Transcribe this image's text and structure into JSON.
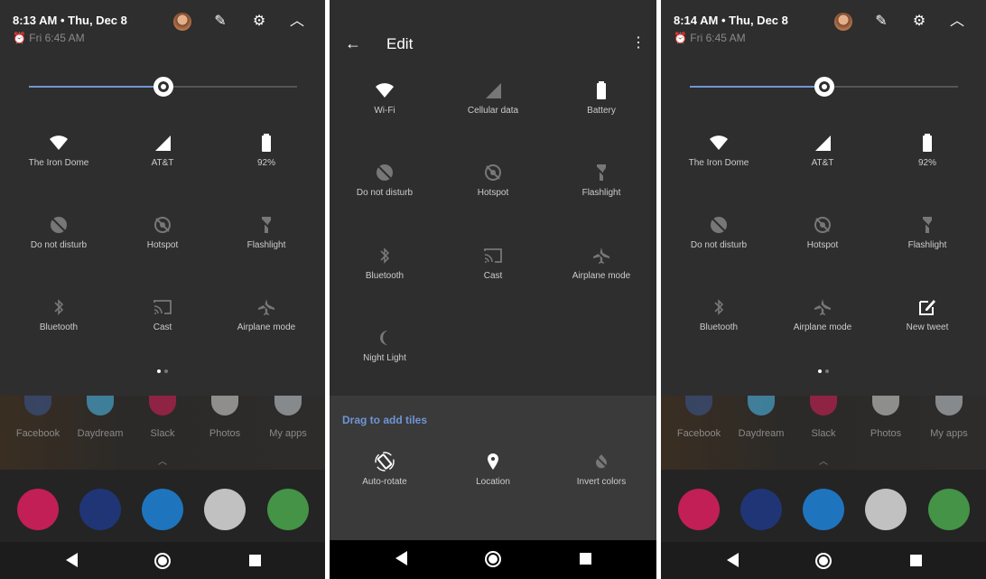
{
  "colors": {
    "accent": "#6f95d6",
    "active_icon": "#ffffff",
    "inactive_icon": "#777777"
  },
  "panel1": {
    "time": "8:13 AM • Thu, Dec 8",
    "alarm": "Fri 6:45 AM",
    "brightness": 0.5,
    "tiles": [
      {
        "label": "The Iron Dome",
        "icon": "wifi-icon",
        "active": true
      },
      {
        "label": "AT&T",
        "icon": "cellular-icon",
        "active": true
      },
      {
        "label": "92%",
        "icon": "battery-icon",
        "active": true
      },
      {
        "label": "Do not disturb",
        "icon": "dnd-icon",
        "active": false
      },
      {
        "label": "Hotspot",
        "icon": "hotspot-icon",
        "active": false
      },
      {
        "label": "Flashlight",
        "icon": "flashlight-icon",
        "active": false
      },
      {
        "label": "Bluetooth",
        "icon": "bluetooth-icon",
        "active": false
      },
      {
        "label": "Cast",
        "icon": "cast-icon",
        "active": false
      },
      {
        "label": "Airplane mode",
        "icon": "airplane-icon",
        "active": false
      }
    ],
    "page": 1,
    "pages": 2
  },
  "panel2": {
    "title": "Edit",
    "tiles": [
      {
        "label": "Wi-Fi",
        "icon": "wifi-icon",
        "active": true
      },
      {
        "label": "Cellular data",
        "icon": "cellular-icon",
        "active": false
      },
      {
        "label": "Battery",
        "icon": "battery-icon",
        "active": true
      },
      {
        "label": "Do not disturb",
        "icon": "dnd-icon",
        "active": false
      },
      {
        "label": "Hotspot",
        "icon": "hotspot-icon",
        "active": false
      },
      {
        "label": "Flashlight",
        "icon": "flashlight-icon",
        "active": false
      },
      {
        "label": "Bluetooth",
        "icon": "bluetooth-icon",
        "active": false
      },
      {
        "label": "Cast",
        "icon": "cast-icon",
        "active": false
      },
      {
        "label": "Airplane mode",
        "icon": "airplane-icon",
        "active": false
      },
      {
        "label": "Night Light",
        "icon": "moon-icon",
        "active": false
      }
    ],
    "drag_label": "Drag to add tiles",
    "extra_tiles": [
      {
        "label": "Auto-rotate",
        "icon": "rotate-icon",
        "active": true
      },
      {
        "label": "Location",
        "icon": "location-icon",
        "active": true
      },
      {
        "label": "Invert colors",
        "icon": "invert-icon",
        "active": false
      }
    ]
  },
  "panel3": {
    "time": "8:14 AM • Thu, Dec 8",
    "alarm": "Fri 6:45 AM",
    "brightness": 0.5,
    "tiles": [
      {
        "label": "The Iron Dome",
        "icon": "wifi-icon",
        "active": true
      },
      {
        "label": "AT&T",
        "icon": "cellular-icon",
        "active": true
      },
      {
        "label": "92%",
        "icon": "battery-icon",
        "active": true
      },
      {
        "label": "Do not disturb",
        "icon": "dnd-icon",
        "active": false
      },
      {
        "label": "Hotspot",
        "icon": "hotspot-icon",
        "active": false
      },
      {
        "label": "Flashlight",
        "icon": "flashlight-icon",
        "active": false
      },
      {
        "label": "Bluetooth",
        "icon": "bluetooth-icon",
        "active": false
      },
      {
        "label": "Airplane mode",
        "icon": "airplane-icon",
        "active": false
      },
      {
        "label": "New tweet",
        "icon": "compose-icon",
        "active": true
      }
    ],
    "page": 1,
    "pages": 2
  },
  "home_apps": [
    {
      "label": "Facebook",
      "color": "#3b5998"
    },
    {
      "label": "Daydream",
      "color": "#4fc3f7"
    },
    {
      "label": "Slack",
      "color": "#e01e5a"
    },
    {
      "label": "Photos",
      "color": "#e0e0e0"
    },
    {
      "label": "My apps",
      "color": "#cfd8dc"
    }
  ],
  "dock": [
    {
      "name": "flamingo-app-icon",
      "color": "#e91e63"
    },
    {
      "name": "messages-app-icon",
      "color": "#1e3a8a"
    },
    {
      "name": "messenger-app-icon",
      "color": "#1e88e5"
    },
    {
      "name": "gmail-app-icon",
      "color": "#e8e8e8"
    },
    {
      "name": "chrome-app-icon",
      "color": "#4caf50"
    }
  ]
}
